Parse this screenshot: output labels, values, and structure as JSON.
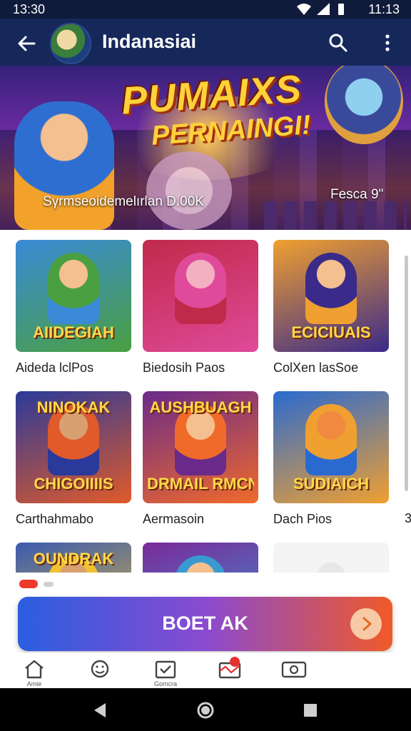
{
  "status_bar": {
    "time_left": "13:30",
    "time_right": "11:13"
  },
  "app_bar": {
    "title": "Indanasiai"
  },
  "hero": {
    "headline": "PUMAIXS",
    "subline": "PERNAINGI!",
    "caption_left": "Sγrmseoidemelırlan D.00K",
    "caption_right": "Fesca 9\""
  },
  "games": [
    {
      "label": "Aideda lclPos",
      "art_text": "AIIDEGIAH",
      "colors": [
        "#3a8ad8",
        "#4aa040",
        "#f4c08f"
      ]
    },
    {
      "label": "Biedosih Paos",
      "art_text": "",
      "colors": [
        "#c02a4a",
        "#e04a9a",
        "#f2b0c0"
      ]
    },
    {
      "label": "ColXen lasSoe",
      "art_text": "ECICIUAIS",
      "colors": [
        "#f0a030",
        "#3a2a8a",
        "#f4c08f"
      ]
    },
    {
      "label": "Carthahmabo",
      "art_text": "CHIGOIIIIS",
      "art_top": "NINOKAK",
      "colors": [
        "#2a3a9a",
        "#e05a2a",
        "#d8a070"
      ]
    },
    {
      "label": "Aermasoin",
      "art_text": "DRMAIL RMCNAR",
      "art_top": "AUSHBUAGH",
      "colors": [
        "#6a2a8a",
        "#f06a2a",
        "#f4c08f"
      ]
    },
    {
      "label": "Dach Pios",
      "art_text": "SUDIAICH",
      "colors": [
        "#2a6ad0",
        "#f0a030",
        "#f08a40"
      ]
    },
    {
      "label": "",
      "art_text": "",
      "art_top": "OUNDRAK",
      "colors": [
        "#3a5ab0",
        "#f0c030",
        "#d8a070"
      ]
    },
    {
      "label": "",
      "art_text": "",
      "colors": [
        "#7a2a9a",
        "#3a9ad0",
        "#f4c08f"
      ]
    },
    {
      "label": "",
      "art_text": "",
      "colors": [
        "#f4f4f4",
        "#f4f4f4",
        "#e8e8e8"
      ]
    }
  ],
  "edge_label": "3",
  "cta": {
    "label": "BOET AK"
  },
  "bottom_nav": [
    {
      "name": "home",
      "label": "Amie"
    },
    {
      "name": "games",
      "label": ""
    },
    {
      "name": "checklist",
      "label": "Gomcra"
    },
    {
      "name": "notifications",
      "label": ""
    },
    {
      "name": "media",
      "label": ""
    }
  ],
  "accent_colors": {
    "primary": "#16285a",
    "cta_start": "#2a5ee0",
    "cta_end": "#f05a28",
    "pager_active": "#ee3a2a"
  }
}
